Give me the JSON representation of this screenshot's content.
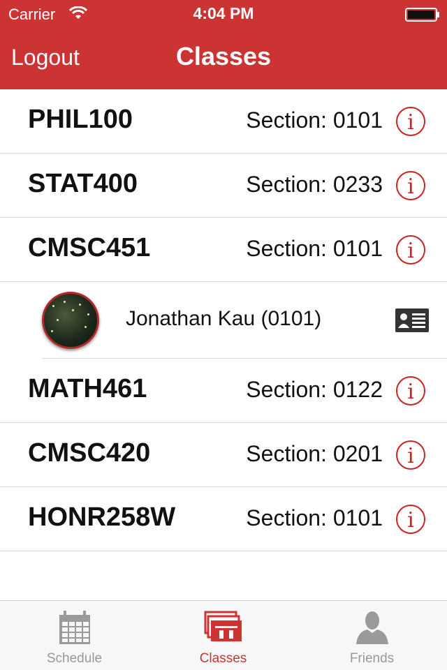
{
  "status_bar": {
    "carrier": "Carrier",
    "time": "4:04 PM"
  },
  "nav": {
    "left_button": "Logout",
    "title": "Classes"
  },
  "classes": [
    {
      "course": "PHIL100",
      "section": "Section: 0101"
    },
    {
      "course": "STAT400",
      "section": "Section: 0233"
    },
    {
      "course": "CMSC451",
      "section": "Section: 0101"
    },
    {
      "course": "MATH461",
      "section": "Section: 0122"
    },
    {
      "course": "CMSC420",
      "section": "Section: 0201"
    },
    {
      "course": "HONR258W",
      "section": "Section: 0101"
    }
  ],
  "friend": {
    "name": "Jonathan Kau (0101)"
  },
  "tabs": [
    {
      "label": "Schedule",
      "icon": "calendar-icon",
      "active": false
    },
    {
      "label": "Classes",
      "icon": "classes-icon",
      "active": true
    },
    {
      "label": "Friends",
      "icon": "person-icon",
      "active": false
    }
  ],
  "colors": {
    "accent": "#cc3333",
    "tab_inactive": "#999999",
    "separator": "#d6d6d6"
  }
}
